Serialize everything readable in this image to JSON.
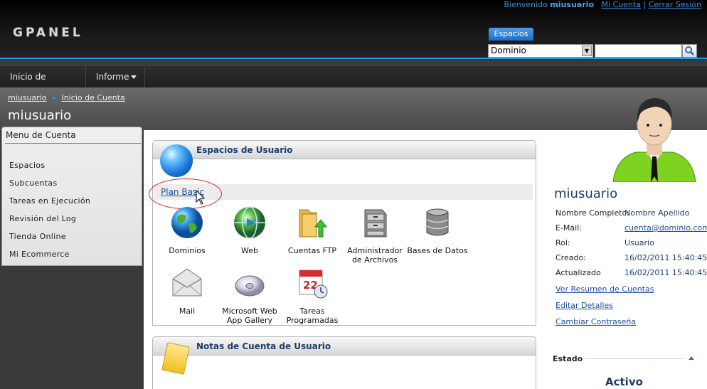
{
  "header": {
    "logo": "GPANEL",
    "welcome_text": "Bienvenido",
    "username": "miusuario",
    "my_account_link": "Mi Cuenta",
    "separator": "|",
    "logout_link": "Cerrar Sesión",
    "search_tab": "Espacios",
    "search_select_value": "Dominio",
    "search_placeholder": ""
  },
  "nav": {
    "items": [
      {
        "label": "Inicio de Cuenta"
      },
      {
        "label": "Informe"
      }
    ]
  },
  "breadcrumb": [
    "miusuario",
    "Inicio de Cuenta"
  ],
  "page_title": "miusuario",
  "left_menu": {
    "title": "Menu de Cuenta",
    "items": [
      {
        "label": "Espacios"
      },
      {
        "label": "Subcuentas"
      },
      {
        "label": "Tareas en Ejecución"
      },
      {
        "label": "Revisión del Log"
      },
      {
        "label": "Tienda Online"
      },
      {
        "label": "Mi Ecommerce"
      }
    ]
  },
  "spaces_panel": {
    "title": "Espacios de Usuario",
    "plan_link": "Plan Basic",
    "tiles": [
      {
        "label": "Dominios",
        "icon": "globe-icon"
      },
      {
        "label": "Web",
        "icon": "web-globe-icon"
      },
      {
        "label": "Cuentas FTP",
        "icon": "ftp-folder-icon"
      },
      {
        "label": "Administrador de Archivos",
        "icon": "file-cabinet-icon"
      },
      {
        "label": "Bases de Datos",
        "icon": "database-icon"
      },
      {
        "label": "Mail",
        "icon": "envelope-icon"
      },
      {
        "label": "Microsoft Web App Gallery",
        "icon": "disc-icon"
      },
      {
        "label": "Tareas Programadas",
        "icon": "calendar-clock-icon"
      }
    ]
  },
  "notes_panel": {
    "title": "Notas de Cuenta de Usuario"
  },
  "profile": {
    "name": "miusuario",
    "fields": [
      {
        "label": "Nombre Completo:",
        "value": "Nombre Apellido"
      },
      {
        "label": "E-Mail:",
        "value": "cuenta@dominio.com.ar"
      },
      {
        "label": "Rol:",
        "value": "Usuario"
      },
      {
        "label": "Creado:",
        "value": "16/02/2011 15:40:45"
      },
      {
        "label": "Actualizado",
        "value": "16/02/2011 15:40:45"
      }
    ],
    "actions": [
      {
        "label": "Ver Resumen de Cuentas"
      },
      {
        "label": "Editar Detalles"
      },
      {
        "label": "Cambiar Contraseña"
      }
    ],
    "status_heading": "Estado",
    "status_value": "Activo"
  },
  "colors": {
    "accent_blue": "#1e9cf0",
    "link_blue": "#1f4e9a",
    "title_navy": "#1d3d6a",
    "avatar_green": "#7ed321",
    "annotation_red": "#dd2222"
  }
}
